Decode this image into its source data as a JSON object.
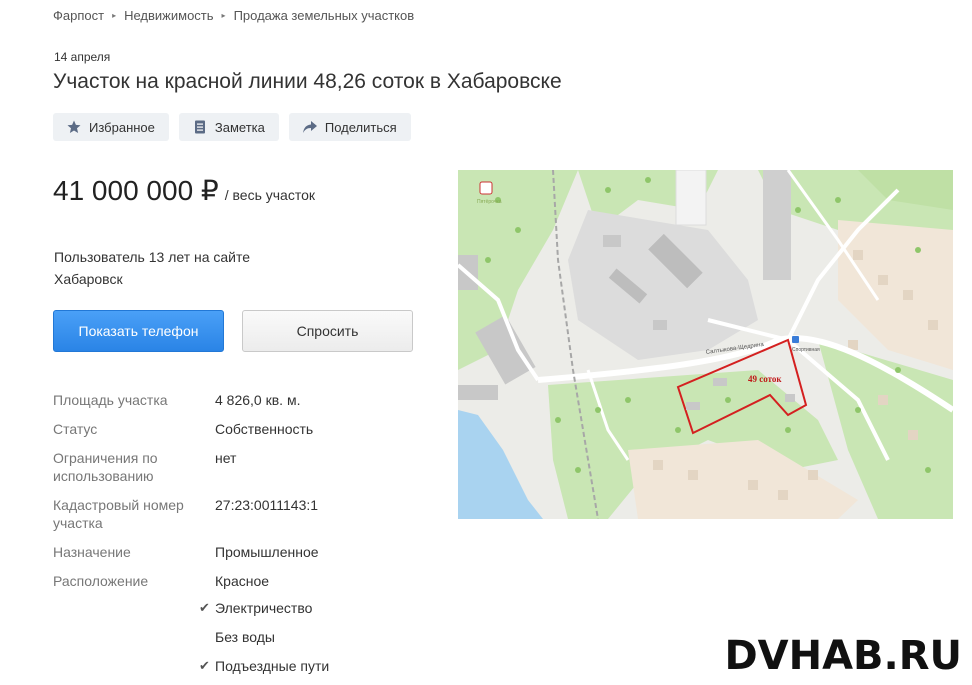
{
  "breadcrumb": [
    "Фарпост",
    "Недвижимость",
    "Продажа земельных участков"
  ],
  "date": "14 апреля",
  "title": "Участок на красной линии 48,26 соток в Хабаровске",
  "actions": {
    "favorite": "Избранное",
    "note": "Заметка",
    "share": "Поделиться"
  },
  "price": {
    "amount": "41 000 000 ₽",
    "unit": "/ весь участок"
  },
  "user": {
    "since": "Пользователь 13 лет на сайте",
    "city": "Хабаровск"
  },
  "buttons": {
    "phone": "Показать телефон",
    "ask": "Спросить"
  },
  "specs": [
    {
      "key": "Площадь участка",
      "value": "4 826,0 кв. м."
    },
    {
      "key": "Статус",
      "value": "Собственность"
    },
    {
      "key": "Ограничения по использованию",
      "value": "нет"
    },
    {
      "key": "Кадастровый номер участка",
      "value": "27:23:0011143:1"
    },
    {
      "key": "Назначение",
      "value": "Промышленное"
    },
    {
      "key": "Расположение",
      "value": "Красное"
    }
  ],
  "features": [
    {
      "label": "Электричество",
      "checked": true
    },
    {
      "label": "Без воды",
      "checked": false
    },
    {
      "label": "Подъездные пути",
      "checked": true
    }
  ],
  "map": {
    "plot_label": "49 соток",
    "street": "Салтыкова-Щедрина",
    "stop": "Спортивная",
    "poi": "Пятёрочка"
  },
  "watermark": "DVHAB.RU",
  "colors": {
    "accent": "#2e8cf0",
    "plot_outline": "#d42020",
    "water": "#a9d3f0",
    "park": "#c9e6b4"
  }
}
